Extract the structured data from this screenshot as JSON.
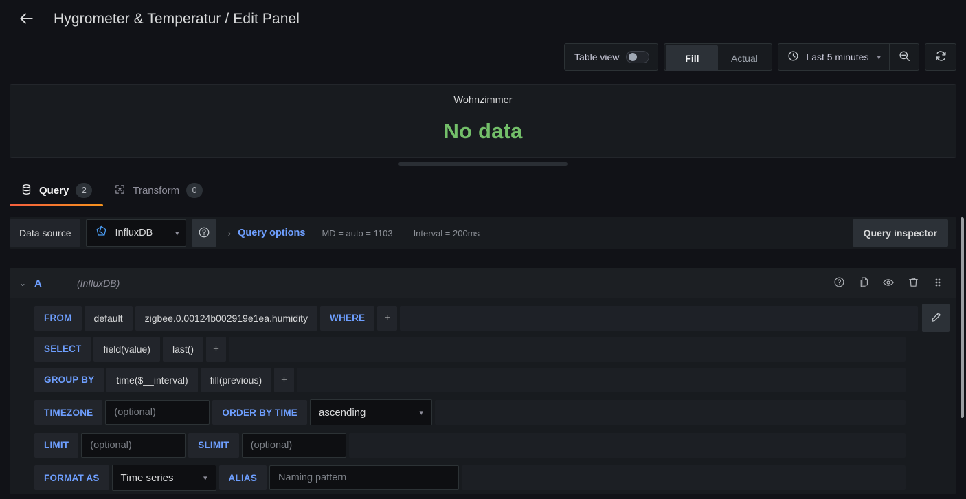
{
  "header": {
    "back_icon": "arrow-left-icon",
    "title": "Hygrometer & Temperatur / Edit Panel"
  },
  "toolbar": {
    "table_view_label": "Table view",
    "table_view_enabled": false,
    "fill_actual": {
      "options": [
        "Fill",
        "Actual"
      ],
      "selected": "Fill"
    },
    "time_picker": {
      "icon": "clock-icon",
      "value": "Last 5 minutes"
    },
    "zoom_out_icon": "zoom-out-icon",
    "refresh_icon": "refresh-icon"
  },
  "panel_preview": {
    "title": "Wohnzimmer",
    "state_text": "No data",
    "state_color": "#73bf69"
  },
  "tabs": [
    {
      "label": "Query",
      "badge": "2",
      "icon": "database-icon",
      "active": true
    },
    {
      "label": "Transform",
      "badge": "0",
      "icon": "transform-icon",
      "active": false
    }
  ],
  "datasource_row": {
    "label": "Data source",
    "name": "InfluxDB",
    "help_icon": "help-circle-icon",
    "query_options_label": "Query options",
    "md_info": "MD = auto = 1103",
    "interval_info": "Interval = 200ms",
    "inspector_label": "Query inspector"
  },
  "query": {
    "ref_id": "A",
    "datasource_note": "(InfluxDB)",
    "actions": [
      "help-circle-icon",
      "copy-icon",
      "eye-icon",
      "trash-icon",
      "drag-handle-icon"
    ],
    "edit_icon": "pencil-icon",
    "rows": {
      "from": {
        "key": "FROM",
        "policy": "default",
        "measurement": "zigbee.0.00124b002919e1ea.humidity",
        "where_key": "WHERE",
        "plus": "+"
      },
      "select": {
        "key": "SELECT",
        "field": "field(value)",
        "func": "last()",
        "plus": "+"
      },
      "group_by": {
        "key": "GROUP BY",
        "time": "time($__interval)",
        "fill": "fill(previous)",
        "plus": "+"
      },
      "timezone": {
        "key": "TIMEZONE",
        "placeholder": "(optional)",
        "value": ""
      },
      "order_by": {
        "key": "ORDER BY TIME",
        "value": "ascending"
      },
      "limit": {
        "key": "LIMIT",
        "placeholder": "(optional)",
        "value": ""
      },
      "slimit": {
        "key": "SLIMIT",
        "placeholder": "(optional)",
        "value": ""
      },
      "format_as": {
        "key": "FORMAT AS",
        "value": "Time series"
      },
      "alias": {
        "key": "ALIAS",
        "placeholder": "Naming pattern",
        "value": ""
      }
    }
  },
  "colors": {
    "accent_blue": "#6e9fff",
    "tab_underline_start": "#f55f3e",
    "tab_underline_end": "#f7931e",
    "no_data_green": "#73bf69",
    "background": "#111217",
    "surface": "#181b1f"
  }
}
